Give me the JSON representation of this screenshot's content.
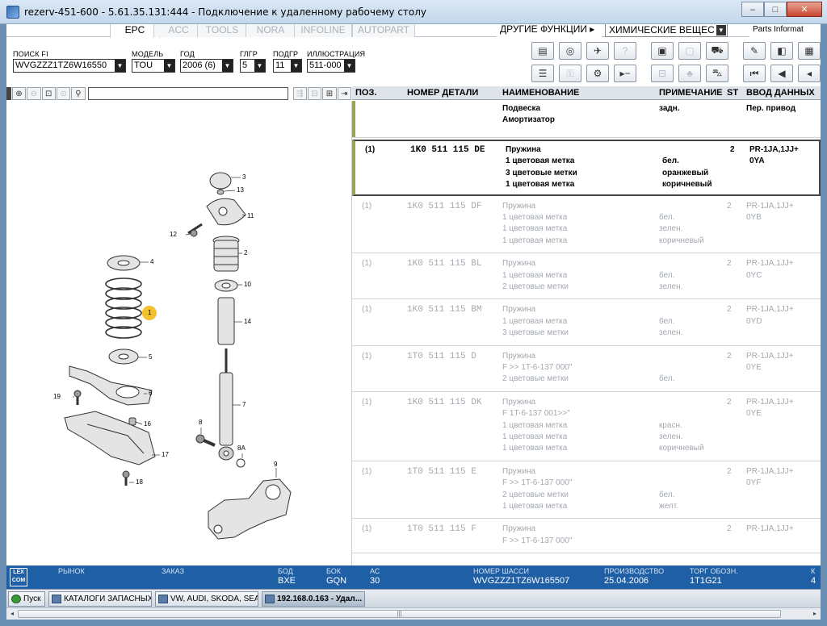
{
  "window": {
    "title": "rezerv-451-600 - 5.61.35.131:444 - Подключение к удаленному рабочему столу",
    "minimize_label": "–",
    "maximize_label": "□",
    "close_label": "✕"
  },
  "tabs": [
    {
      "label": "EPC",
      "active": true
    },
    {
      "label": "ACC",
      "active": false
    },
    {
      "label": "TOOLS",
      "active": false
    },
    {
      "label": "NORA",
      "active": false
    },
    {
      "label": "INFOLINE",
      "active": false
    },
    {
      "label": "AUTOPART",
      "active": false
    }
  ],
  "menus": {
    "other_functions": "ДРУГИЕ ФУНКЦИИ ▸",
    "chemicals": "ХИМИЧЕСКИЕ ВЕЩЕС",
    "parts_info": "Parts Informat"
  },
  "selectors": {
    "vin": {
      "label": "ПОИСК FI",
      "value": "WVGZZZ1TZ6W16550"
    },
    "model": {
      "label": "МОДЕЛЬ",
      "value": "TOU"
    },
    "year": {
      "label": "ГОД",
      "value": "2006 (6)"
    },
    "main_group": {
      "label": "ГЛГР",
      "value": "5"
    },
    "sub_group": {
      "label": "ПОДГР",
      "value": "11"
    },
    "illustration": {
      "label": "ИЛЛЮСТРАЦИЯ",
      "value": "511-000"
    }
  },
  "table": {
    "headers": {
      "pos": "ПОЗ.",
      "part_no": "НОМЕР ДЕТАЛИ",
      "name": "НАИМЕНОВАНИЕ",
      "note": "ПРИМЕЧАНИЕ",
      "st": "ST",
      "input": "ВВОД ДАННЫХ"
    },
    "group": {
      "name_lines": [
        "Подвеска",
        "Амортизатор"
      ],
      "note": "задн.",
      "input": "Пер. привод"
    },
    "rows": [
      {
        "pos": "(1)",
        "part": "1K0 511 115 DE",
        "name": [
          "Пружина",
          "1 цветовая метка",
          "3 цветовые метки",
          "1 цветовая метка"
        ],
        "note": [
          "",
          "бел.",
          "оранжевый",
          "коричневый"
        ],
        "st": "2",
        "input": [
          "PR-1JA,1JJ+",
          "0YA"
        ]
      },
      {
        "pos": "(1)",
        "part": "1K0 511 115 DF",
        "name": [
          "Пружина",
          "1 цветовая метка",
          "1 цветовая метка",
          "1 цветовая метка"
        ],
        "note": [
          "",
          "бел.",
          "зелен.",
          "коричневый"
        ],
        "st": "2",
        "input": [
          "PR-1JA,1JJ+",
          "0YB"
        ]
      },
      {
        "pos": "(1)",
        "part": "1K0 511 115 BL",
        "name": [
          "Пружина",
          "1 цветовая метка",
          "2 цветовые метки"
        ],
        "note": [
          "",
          "бел.",
          "зелен."
        ],
        "st": "2",
        "input": [
          "PR-1JA,1JJ+",
          "0YC"
        ]
      },
      {
        "pos": "(1)",
        "part": "1K0 511 115 BM",
        "name": [
          "Пружина",
          "1 цветовая метка",
          "3 цветовые метки"
        ],
        "note": [
          "",
          "бел.",
          "зелен."
        ],
        "st": "2",
        "input": [
          "PR-1JA,1JJ+",
          "0YD"
        ]
      },
      {
        "pos": "(1)",
        "part": "1T0 511 115 D",
        "name": [
          "Пружина",
          "F          >> 1T-6-137 000\"",
          "2 цветовые метки"
        ],
        "note": [
          "",
          "",
          "бел."
        ],
        "st": "2",
        "input": [
          "PR-1JA,1JJ+",
          "0YE"
        ]
      },
      {
        "pos": "(1)",
        "part": "1K0 511 115 DK",
        "name": [
          "Пружина",
          "F 1T-6-137 001>>\"",
          "1 цветовая метка",
          "1 цветовая метка",
          "1 цветовая метка"
        ],
        "note": [
          "",
          "",
          "красн.",
          "зелен.",
          "коричневый"
        ],
        "st": "2",
        "input": [
          "PR-1JA,1JJ+",
          "0YE"
        ]
      },
      {
        "pos": "(1)",
        "part": "1T0 511 115 E",
        "name": [
          "Пружина",
          "F          >> 1T-6-137 000\"",
          "2 цветовые метки",
          "1 цветовая метка"
        ],
        "note": [
          "",
          "",
          "бел.",
          "желт."
        ],
        "st": "2",
        "input": [
          "PR-1JA,1JJ+",
          "0YF"
        ]
      },
      {
        "pos": "(1)",
        "part": "1T0 511 115 F",
        "name": [
          "Пружина",
          "F          >> 1T-6-137 000\""
        ],
        "note": [
          "",
          ""
        ],
        "st": "2",
        "input": [
          "PR-1JA,1JJ+",
          ""
        ]
      }
    ]
  },
  "diagram": {
    "callouts": [
      "3",
      "13",
      "11",
      "12",
      "2",
      "4",
      "10",
      "1",
      "14",
      "5",
      "6",
      "19",
      "16",
      "7",
      "17",
      "8",
      "8A",
      "18",
      "9"
    ]
  },
  "status": {
    "logo": "LEX\nCOM",
    "market_label": "РЫНОК",
    "order_label": "ЗАКАЗ",
    "bod_label": "БОД",
    "bod_value": "BXE",
    "bok_label": "БОК",
    "bok_value": "GQN",
    "ac_label": "АС",
    "ac_value": "30",
    "chassis_label": "НОМЕР ШАССИ",
    "chassis_value": "WVGZZZ1TZ6W165507",
    "prod_label": "ПРОИЗВОДСТВО",
    "prod_value": "25.04.2006",
    "trade_label": "ТОРГ ОБОЗН.",
    "trade_value": "1T1G21",
    "extra_label": "К",
    "extra_value": "4"
  },
  "taskbar": {
    "start": "Пуск",
    "items": [
      "КАТАЛОГИ ЗАПАСНЫХ ...",
      "VW, AUDI, SKODA, SEAT",
      "192.168.0.163 - Удал..."
    ]
  },
  "colors": {
    "accent": "#1e5fa5",
    "callout": "#f3c12b",
    "group_mark": "#9aa35a"
  }
}
